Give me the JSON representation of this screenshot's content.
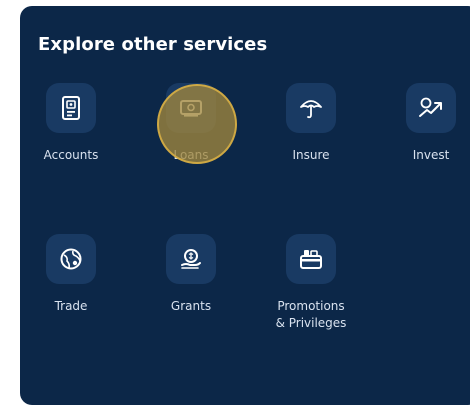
{
  "panel": {
    "title": "Explore other services"
  },
  "services": [
    {
      "label": "Accounts",
      "icon": "account-book-icon"
    },
    {
      "label": "Loans",
      "icon": "cash-note-icon"
    },
    {
      "label": "Insure",
      "icon": "umbrella-icon"
    },
    {
      "label": "Invest",
      "icon": "invest-growth-icon"
    },
    {
      "label": "Trade",
      "icon": "globe-trade-icon"
    },
    {
      "label": "Grants",
      "icon": "coin-hand-icon"
    },
    {
      "label": "Promotions & Privileges",
      "label_line1": "Promotions",
      "label_line2": "& Privileges",
      "icon": "card-gift-icon"
    }
  ],
  "colors": {
    "panel_bg": "#0c2748",
    "tile_bg": "#193a63",
    "icon_fill": "#ffffff",
    "label_text": "#d9e2ef",
    "touch_indicator": "#a0873c"
  }
}
